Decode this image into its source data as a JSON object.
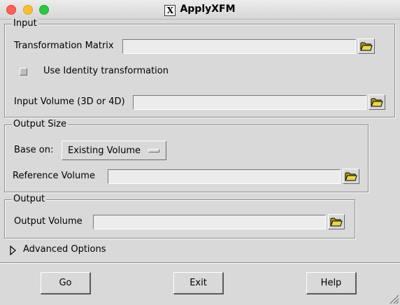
{
  "window": {
    "title": "ApplyXFM",
    "title_icon": "x11-icon"
  },
  "input": {
    "legend": "Input",
    "transformation_matrix_label": "Transformation Matrix",
    "transformation_matrix_value": "",
    "use_identity_label": "Use Identity transformation",
    "use_identity_checked": false,
    "input_volume_label": "Input Volume (3D or 4D)",
    "input_volume_value": ""
  },
  "output_size": {
    "legend": "Output Size",
    "base_on_label": "Base on:",
    "base_on_value": "Existing Volume",
    "reference_volume_label": "Reference Volume",
    "reference_volume_value": ""
  },
  "output": {
    "legend": "Output",
    "output_volume_label": "Output Volume",
    "output_volume_value": ""
  },
  "advanced": {
    "label": "Advanced Options",
    "expanded": false
  },
  "buttons": {
    "go": "Go",
    "exit": "Exit",
    "help": "Help"
  },
  "colors": {
    "background": "#d9d9d9",
    "entry_background": "#ececec",
    "close": "#fe5f57",
    "minimize": "#febc2e",
    "maximize": "#28c840"
  }
}
